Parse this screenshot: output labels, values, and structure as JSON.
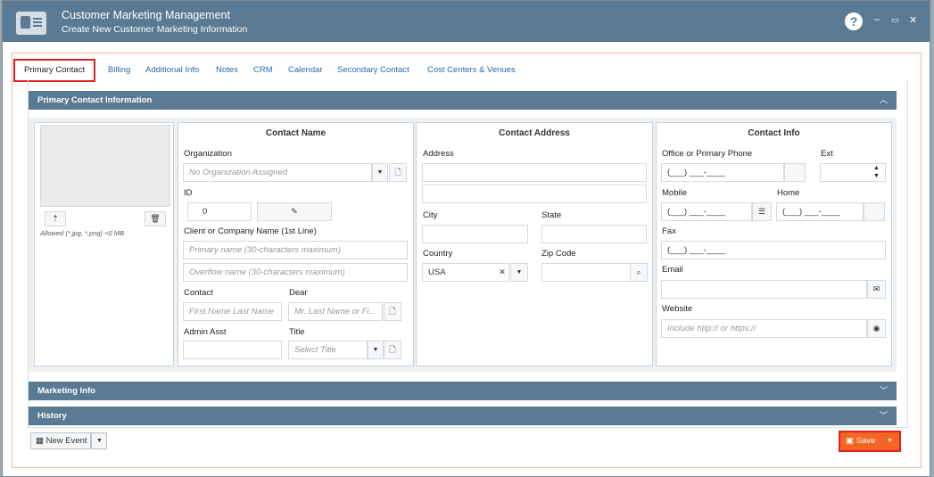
{
  "window": {
    "title": "Customer Marketing Management",
    "subtitle": "Create New Customer Marketing Information",
    "help": "?",
    "minimize": "–",
    "maximize": "▭",
    "close": "✕"
  },
  "tabs": [
    "Primary Contact",
    "Billing",
    "Additional Info",
    "Notes",
    "CRM",
    "Calendar",
    "Secondary Contact",
    "Cost Centers & Venues"
  ],
  "sections": {
    "primary": "Primary Contact Information",
    "marketing": "Marketing Info",
    "history": "History"
  },
  "photo": {
    "allowed": "Allowed (*.jpg, *.png) <0 MB"
  },
  "contact_name": {
    "title": "Contact Name",
    "organization_label": "Organization",
    "organization_placeholder": "No Organization Assigned",
    "id_label": "ID",
    "id_value": "0",
    "client_label": "Client or Company Name (1st Line)",
    "primary_name_placeholder": "Primary name (30-characters maximum)",
    "overflow_name_placeholder": "Overflow name (30-characters maximum)",
    "contact_label": "Contact",
    "contact_placeholder": "First Name Last Name",
    "dear_label": "Dear",
    "dear_placeholder": "Mr. Last Name or Fi...",
    "admin_label": "Admin Asst",
    "title_label": "Title",
    "title_placeholder": "Select Title"
  },
  "contact_address": {
    "title": "Contact Address",
    "address_label": "Address",
    "city_label": "City",
    "state_label": "State",
    "country_label": "Country",
    "country_value": "USA",
    "zip_label": "Zip Code"
  },
  "contact_info": {
    "title": "Contact Info",
    "office_label": "Office or Primary Phone",
    "ext_label": "Ext",
    "phone_mask": "(___) ___-____",
    "mobile_label": "Mobile",
    "home_label": "Home",
    "fax_label": "Fax",
    "email_label": "Email",
    "website_label": "Website",
    "website_placeholder": "Include http:// or https://"
  },
  "footer": {
    "new_event": "New Event",
    "save": "Save"
  },
  "colors": {
    "header": "#5a7a93",
    "save": "#f26522",
    "highlight": "#e02020"
  }
}
